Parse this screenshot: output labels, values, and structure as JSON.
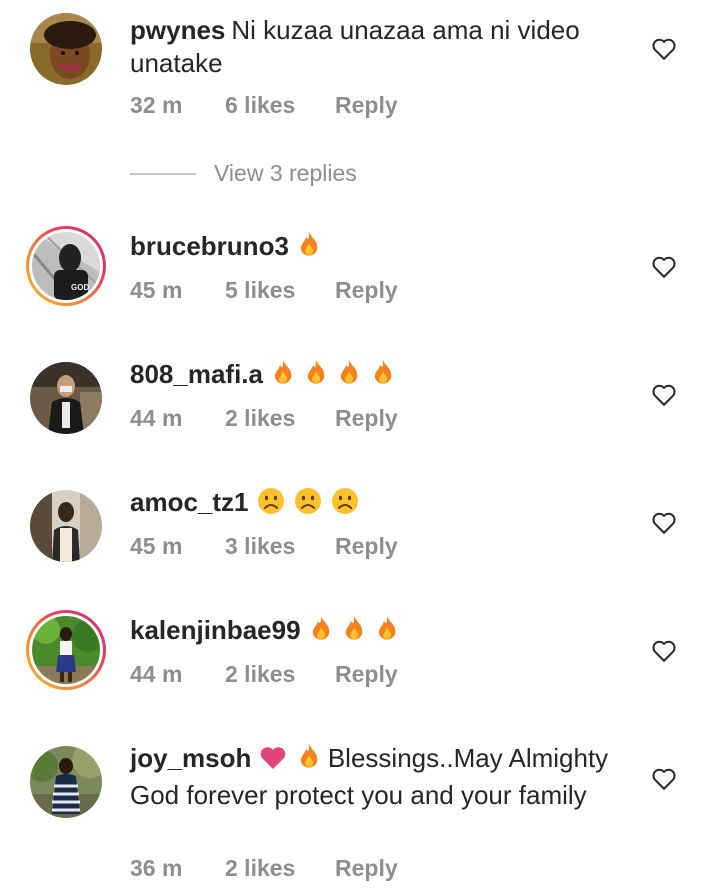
{
  "view_replies": "View 3 replies",
  "comments": [
    {
      "username": "pwynes",
      "text": "Ni kuzaa unazaa ama ni video unatake",
      "emoji": [],
      "time": "32 m",
      "likes": "6 likes",
      "reply": "Reply",
      "story_ring": false
    },
    {
      "username": "brucebruno3",
      "text": "",
      "emoji": [
        "fire"
      ],
      "time": "45 m",
      "likes": "5 likes",
      "reply": "Reply",
      "story_ring": true
    },
    {
      "username": "808_mafi.a",
      "text": "",
      "emoji": [
        "fire",
        "fire",
        "fire",
        "fire"
      ],
      "time": "44 m",
      "likes": "2 likes",
      "reply": "Reply",
      "story_ring": false
    },
    {
      "username": "amoc_tz1",
      "text": "",
      "emoji": [
        "sad-face",
        "sad-face",
        "sad-face"
      ],
      "time": "45 m",
      "likes": "3 likes",
      "reply": "Reply",
      "story_ring": false
    },
    {
      "username": "kalenjinbae99",
      "text": "",
      "emoji": [
        "fire",
        "fire",
        "fire"
      ],
      "time": "44 m",
      "likes": "2 likes",
      "reply": "Reply",
      "story_ring": true
    },
    {
      "username": "joy_msoh",
      "emoji_prefix": [
        "heart",
        "fire"
      ],
      "text": "Blessings..May Almighty God forever protect you and your family",
      "time": "36 m",
      "likes": "2 likes",
      "reply": "Reply",
      "story_ring": false
    }
  ],
  "colors": {
    "text": "#262626",
    "meta": "#8e8e8e",
    "ring_start": "#f9b233",
    "ring_end": "#c13584"
  }
}
